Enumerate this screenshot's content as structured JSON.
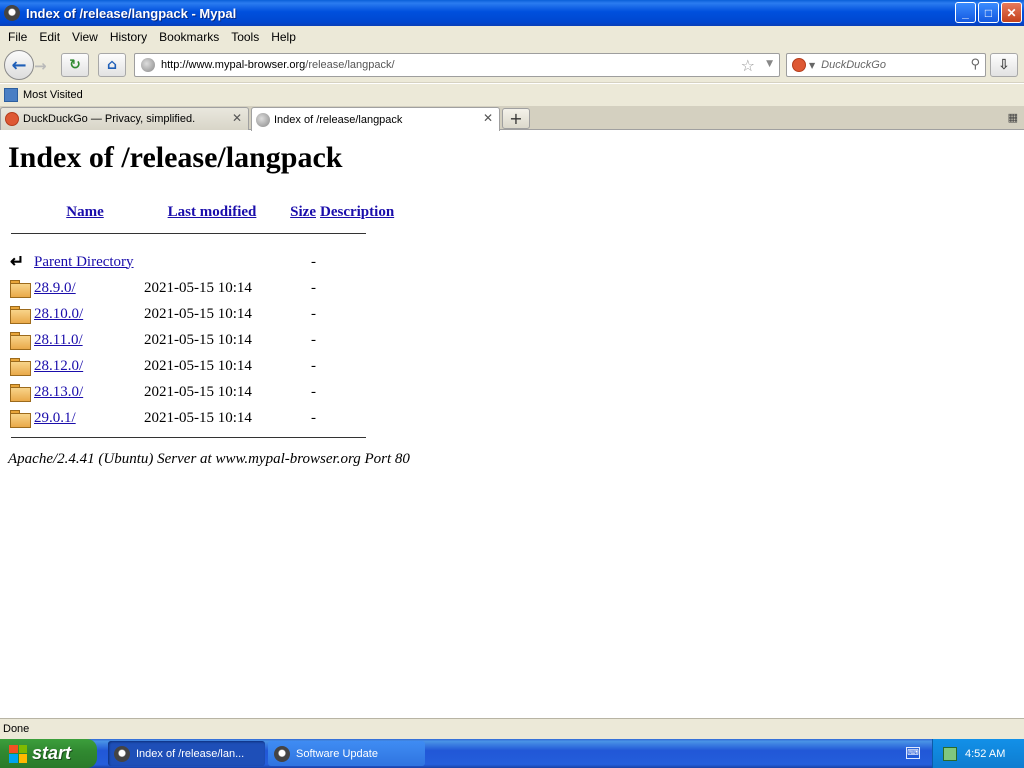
{
  "window": {
    "title": "Index of /release/langpack - Mypal",
    "buttons": {
      "minimize": "_",
      "maximize": "□",
      "close": "✕"
    }
  },
  "menu": [
    {
      "label": "File"
    },
    {
      "label": "Edit"
    },
    {
      "label": "View"
    },
    {
      "label": "History"
    },
    {
      "label": "Bookmarks"
    },
    {
      "label": "Tools"
    },
    {
      "label": "Help"
    }
  ],
  "nav": {
    "url_host": "http://www.mypal-browser.org",
    "url_path": "/release/langpack/",
    "search_placeholder": "DuckDuckGo"
  },
  "bookmarks": {
    "most_visited": "Most Visited"
  },
  "tabs": [
    {
      "label": "DuckDuckGo — Privacy, simplified.",
      "icon": "duckduckgo-icon",
      "active": false
    },
    {
      "label": "Index of /release/langpack",
      "icon": "globe-icon",
      "active": true
    }
  ],
  "page": {
    "heading": "Index of /release/langpack",
    "columns": {
      "name": "Name",
      "modified": "Last modified",
      "size": "Size",
      "description": "Description"
    },
    "parent": {
      "name": "Parent Directory",
      "size": "-"
    },
    "rows": [
      {
        "name": "28.9.0/",
        "modified": "2021-05-15 10:14",
        "size": "-"
      },
      {
        "name": "28.10.0/",
        "modified": "2021-05-15 10:14",
        "size": "-"
      },
      {
        "name": "28.11.0/",
        "modified": "2021-05-15 10:14",
        "size": "-"
      },
      {
        "name": "28.12.0/",
        "modified": "2021-05-15 10:14",
        "size": "-"
      },
      {
        "name": "28.13.0/",
        "modified": "2021-05-15 10:14",
        "size": "-"
      },
      {
        "name": "29.0.1/",
        "modified": "2021-05-15 10:14",
        "size": "-"
      }
    ],
    "address": "Apache/2.4.41 (Ubuntu) Server at www.mypal-browser.org Port 80"
  },
  "status": "Done",
  "taskbar": {
    "start": "start",
    "tasks": [
      {
        "label": "Index of /release/lan...",
        "active": true
      },
      {
        "label": "Software Update",
        "active": false
      }
    ],
    "clock": "4:52 AM"
  },
  "colors": {
    "link": "#1a0dab",
    "titlebar": "#0050dd",
    "chrome": "#ece9d8",
    "start": "#318a31"
  }
}
